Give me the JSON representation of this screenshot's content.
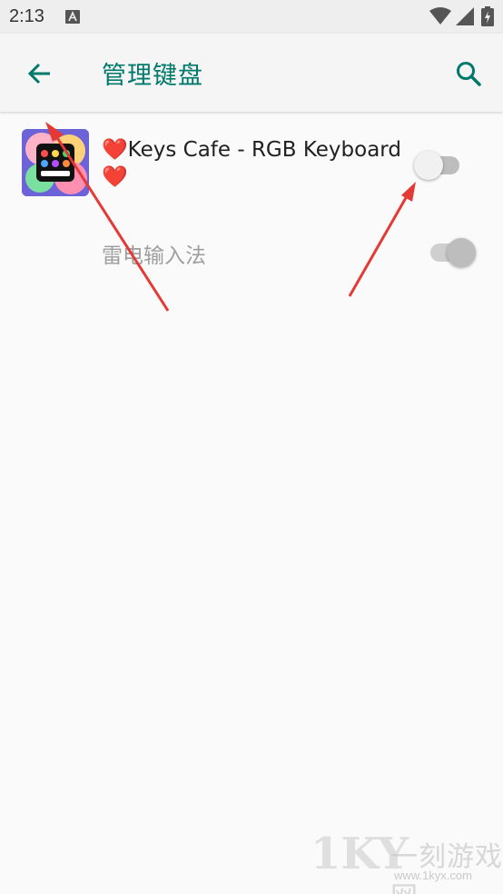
{
  "status_bar": {
    "time": "2:13",
    "icons": [
      "notification-a-icon",
      "wifi-icon",
      "signal-icon",
      "battery-charging-icon"
    ]
  },
  "app_bar": {
    "title": "管理键盘",
    "back_icon": "arrow-left-icon",
    "search_icon": "search-icon",
    "accent_color": "#00796b"
  },
  "keyboards": [
    {
      "name": "❤️Keys Cafe - RGB Keyboard ❤️",
      "enabled": false,
      "toggle_state": "off"
    },
    {
      "name": "雷电输入法",
      "enabled": false,
      "toggle_state": "on-disabled"
    }
  ],
  "watermark": {
    "logo": "1KY",
    "title": "一刻游戏网",
    "url": "www.1kyx.com"
  },
  "annotation_color": "#e53935"
}
